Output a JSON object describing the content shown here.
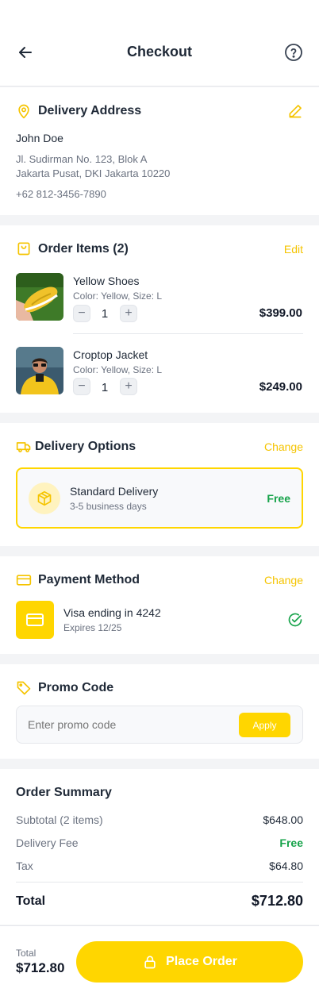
{
  "header": {
    "title": "Checkout"
  },
  "address": {
    "title": "Delivery Address",
    "name": "John Doe",
    "line1": "Jl. Sudirman No. 123, Blok A",
    "line2": "Jakarta Pusat, DKI Jakarta 10220",
    "phone": "+62 812-3456-7890"
  },
  "order": {
    "title": "Order Items (2)",
    "edit_label": "Edit",
    "items": [
      {
        "name": "Yellow Shoes",
        "variant": "Color: Yellow, Size: L",
        "qty": "1",
        "price": "$399.00"
      },
      {
        "name": "Croptop Jacket",
        "variant": "Color: Yellow, Size: L",
        "qty": "1",
        "price": "$249.00"
      }
    ]
  },
  "delivery": {
    "title": "Delivery Options",
    "change_label": "Change",
    "option_name": "Standard Delivery",
    "option_eta": "3-5 business days",
    "option_price": "Free"
  },
  "payment": {
    "title": "Payment Method",
    "change_label": "Change",
    "card_label": "Visa ending in 4242",
    "card_expiry": "Expires 12/25"
  },
  "promo": {
    "title": "Promo Code",
    "placeholder": "Enter promo code",
    "apply_label": "Apply"
  },
  "summary": {
    "title": "Order Summary",
    "subtotal_label": "Subtotal (2 items)",
    "subtotal_value": "$648.00",
    "delivery_label": "Delivery Fee",
    "delivery_value": "Free",
    "tax_label": "Tax",
    "tax_value": "$64.80",
    "total_label": "Total",
    "total_value": "$712.80"
  },
  "footer": {
    "total_label": "Total",
    "total_value": "$712.80",
    "place_order_label": "Place Order"
  },
  "colors": {
    "accent": "#FFD600",
    "success": "#16a34a",
    "text": "#1f2937",
    "muted": "#6b7280"
  }
}
